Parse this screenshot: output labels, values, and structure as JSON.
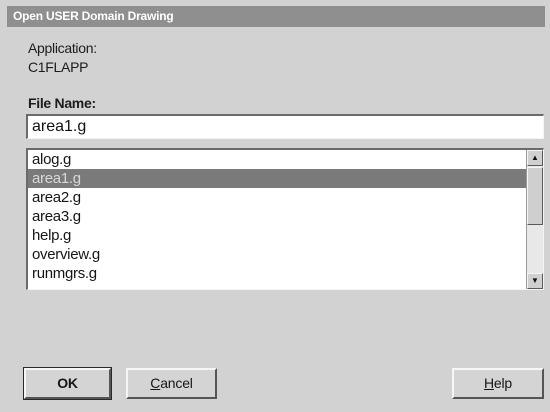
{
  "window": {
    "title": "Open USER Domain Drawing"
  },
  "application": {
    "label": "Application:",
    "value": "C1FLAPP"
  },
  "file_name": {
    "label": "File Name:",
    "value": "area1.g"
  },
  "file_list": {
    "items": [
      "alog.g",
      "area1.g",
      "area2.g",
      "area3.g",
      "help.g",
      "overview.g",
      "runmgrs.g"
    ],
    "selected": "area1.g",
    "selected_index": 1
  },
  "buttons": {
    "ok": "OK",
    "cancel_first": "C",
    "cancel_rest": "ancel",
    "help_first": "H",
    "help_rest": "elp"
  },
  "icons": {
    "scroll_up": "arrow-up-icon",
    "scroll_down": "arrow-down-icon"
  }
}
